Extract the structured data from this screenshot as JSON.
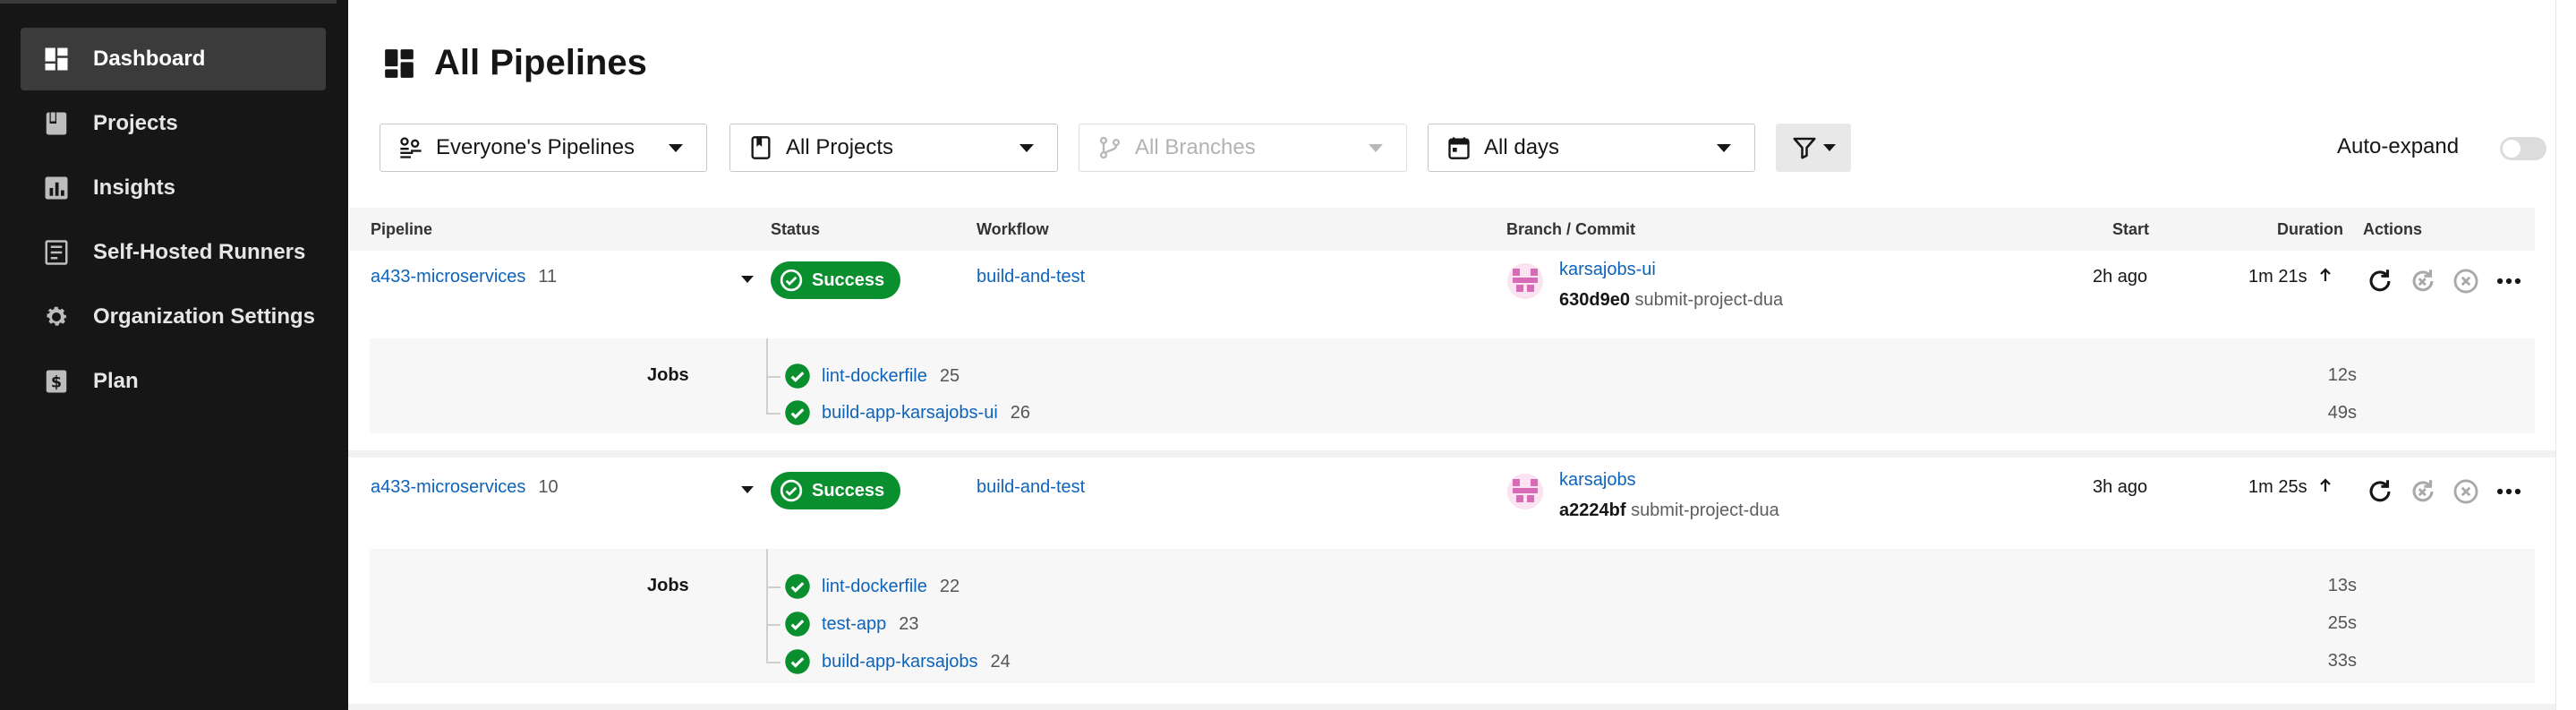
{
  "sidebar": {
    "items": [
      {
        "label": "Dashboard",
        "icon": "dashboard-icon",
        "active": true
      },
      {
        "label": "Projects",
        "icon": "projects-icon",
        "active": false
      },
      {
        "label": "Insights",
        "icon": "insights-icon",
        "active": false
      },
      {
        "label": "Self-Hosted Runners",
        "icon": "runners-icon",
        "active": false
      },
      {
        "label": "Organization Settings",
        "icon": "gear-icon",
        "active": false
      },
      {
        "label": "Plan",
        "icon": "dollar-icon",
        "active": false
      }
    ]
  },
  "page": {
    "title": "All Pipelines"
  },
  "filters": {
    "pipelines": "Everyone's Pipelines",
    "projects": "All Projects",
    "branches": "All Branches",
    "days": "All days",
    "auto_expand_label": "Auto-expand",
    "auto_expand_on": false
  },
  "table": {
    "headers": {
      "pipeline": "Pipeline",
      "status": "Status",
      "workflow": "Workflow",
      "branch_commit": "Branch / Commit",
      "start": "Start",
      "duration": "Duration",
      "actions": "Actions"
    },
    "jobs_label": "Jobs",
    "rows": [
      {
        "project": "a433-microservices",
        "number": "11",
        "status": "Success",
        "workflow": "build-and-test",
        "branch": "karsajobs-ui",
        "commit_sha": "630d9e0",
        "commit_msg": "submit-project-dua",
        "start": "2h ago",
        "duration": "1m 21s",
        "jobs": [
          {
            "name": "lint-dockerfile",
            "number": "25",
            "duration": "12s"
          },
          {
            "name": "build-app-karsajobs-ui",
            "number": "26",
            "duration": "49s"
          }
        ]
      },
      {
        "project": "a433-microservices",
        "number": "10",
        "status": "Success",
        "workflow": "build-and-test",
        "branch": "karsajobs",
        "commit_sha": "a2224bf",
        "commit_msg": "submit-project-dua",
        "start": "3h ago",
        "duration": "1m 25s",
        "jobs": [
          {
            "name": "lint-dockerfile",
            "number": "22",
            "duration": "13s"
          },
          {
            "name": "test-app",
            "number": "23",
            "duration": "25s"
          },
          {
            "name": "build-app-karsajobs",
            "number": "24",
            "duration": "33s"
          }
        ]
      }
    ]
  },
  "colors": {
    "sidebar_bg": "#161616",
    "success": "#0a8f2f",
    "link": "#0d63ba"
  }
}
